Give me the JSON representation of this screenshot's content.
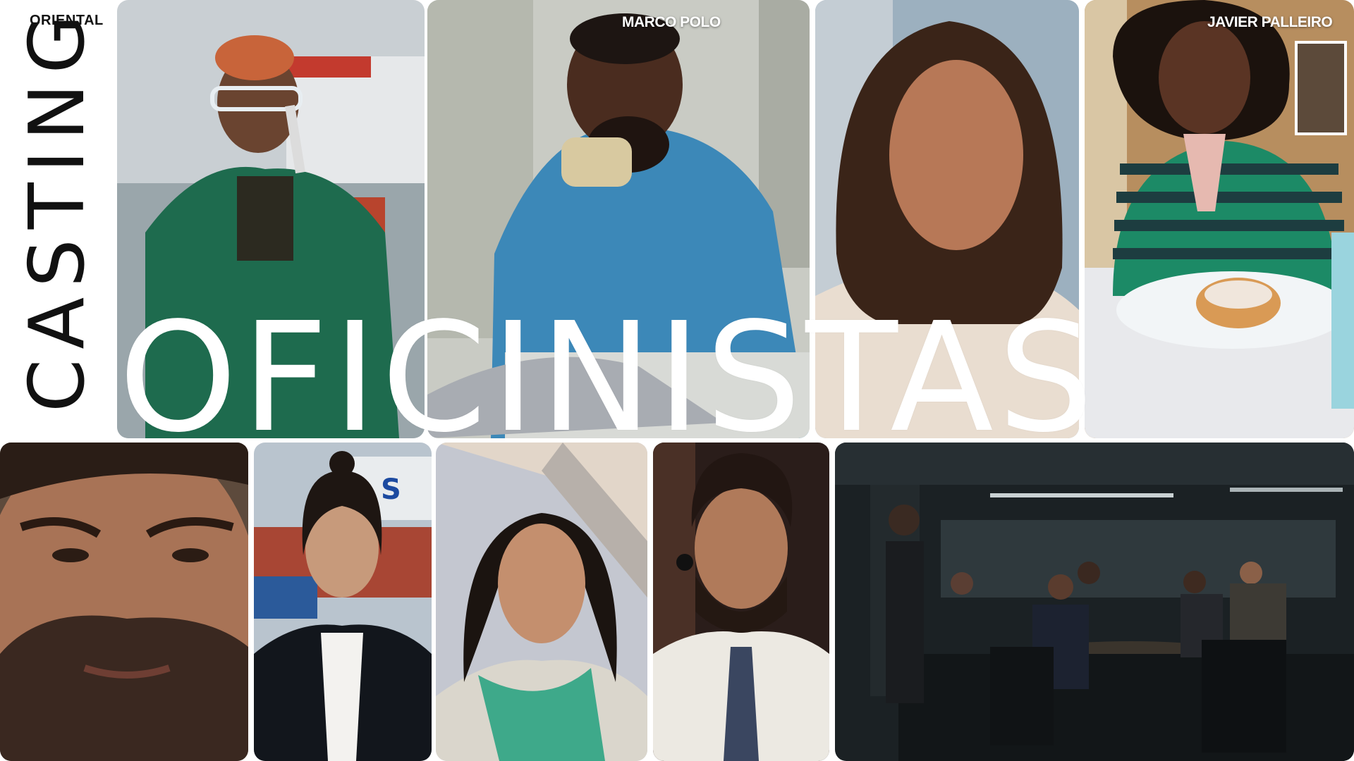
{
  "brand": "ORIENTAL",
  "vertical_title": "CASTING",
  "headline": "OFICINISTAS",
  "credits": [
    "MARCO POLO",
    "JAVIER PALLEIRO"
  ],
  "colors": {
    "background": "#ffffff",
    "text_dark": "#111111",
    "text_light": "#ffffff"
  }
}
